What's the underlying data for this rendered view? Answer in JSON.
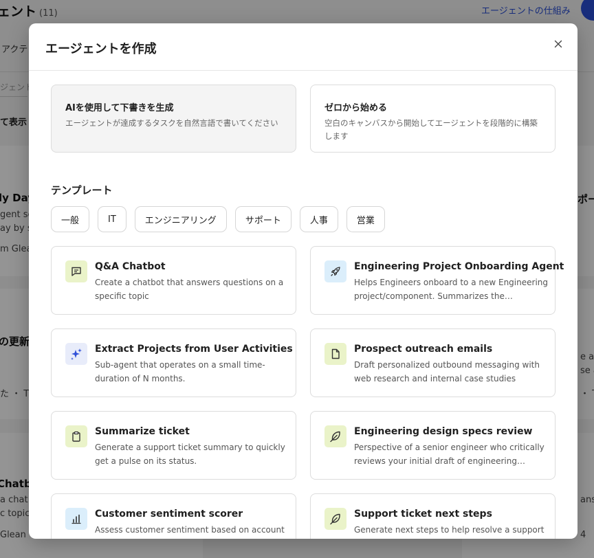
{
  "background": {
    "title": "ェント",
    "count": "(11)",
    "how_link": "エージェントの仕組み",
    "tab_partial": "アクテ",
    "search_partial": "ジェント",
    "view_partial": "て表示",
    "left_cards": [
      {
        "title": "ly Day",
        "line1": "gent se",
        "line2": "ay by s",
        "footer": "m Glea"
      },
      {
        "title": "の更新",
        "footer": "た ・ T"
      },
      {
        "title": "Chatbo",
        "line1": "a chat",
        "line2": "c topic",
        "footer": "Glean"
      }
    ],
    "right_cards": [
      {
        "title": "ポー"
      },
      {
        "line1": "e an",
        "line2": "se a",
        "footer": "・ T"
      },
      {
        "line1": "answ",
        "footer": "4"
      }
    ]
  },
  "modal": {
    "title": "エージェントを作成",
    "start_options": [
      {
        "title": "AIを使用して下書きを生成",
        "description": "エージェントが達成するタスクを自然言語で書いてください"
      },
      {
        "title": "ゼロから始める",
        "description": "空白のキャンバスから開始してエージェントを段階的に構築します"
      }
    ],
    "templates_heading": "テンプレート",
    "categories": [
      "一般",
      "IT",
      "エンジニアリング",
      "サポート",
      "人事",
      "営業"
    ],
    "templates": [
      {
        "title": "Q&A Chatbot",
        "description": "Create a chatbot that answers questions on a specific topic",
        "icon": "chat-icon"
      },
      {
        "title": "Engineering Project Onboarding Agent",
        "description": "Helps Engineers onboard to a new Engineering project/component. Summarizes the…",
        "icon": "rocket-icon"
      },
      {
        "title": "Extract Projects from User Activities",
        "description": "Sub-agent that operates on a small time-duration of N months.",
        "icon": "sparkle-icon"
      },
      {
        "title": "Prospect outreach emails",
        "description": "Draft personalized outbound messaging with web research and internal case studies",
        "icon": "document-icon"
      },
      {
        "title": "Summarize ticket",
        "description": "Generate a support ticket summary to quickly get a pulse on its status.",
        "icon": "clipboard-icon"
      },
      {
        "title": "Engineering design specs review",
        "description": "Perspective of a senior engineer who critically reviews your initial draft of engineering design…",
        "icon": "feather-icon"
      },
      {
        "title": "Customer sentiment scorer",
        "description": "Assess customer sentiment based on account",
        "icon": "bar-chart-icon"
      },
      {
        "title": "Support ticket next steps",
        "description": "Generate next steps to help resolve a support",
        "icon": "feather-icon"
      }
    ]
  }
}
